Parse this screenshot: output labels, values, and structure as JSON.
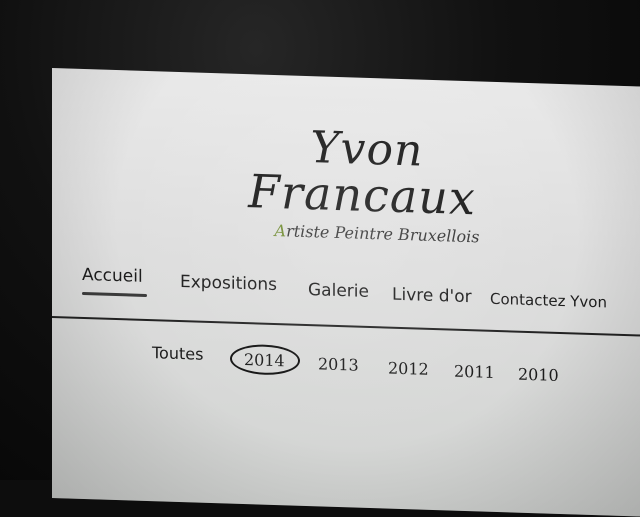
{
  "site": {
    "name_line1": "Yvon",
    "name_line2": "Francaux",
    "tagline_first": "A",
    "tagline_rest": "rtiste Peintre Bruxellois"
  },
  "nav": {
    "items": [
      {
        "label": "Accueil",
        "active": true
      },
      {
        "label": "Expositions",
        "active": false
      },
      {
        "label": "Galerie",
        "active": false
      },
      {
        "label": "Livre d'or",
        "active": false
      },
      {
        "label": "Contactez Yvon",
        "active": false
      }
    ]
  },
  "filters": {
    "items": [
      {
        "label": "Toutes",
        "selected": false
      },
      {
        "label": "2014",
        "selected": true
      },
      {
        "label": "2013",
        "selected": false
      },
      {
        "label": "2012",
        "selected": false
      },
      {
        "label": "2011",
        "selected": false
      },
      {
        "label": "2010",
        "selected": false
      }
    ]
  },
  "colors": {
    "tagline_accent": "#6e8a2e",
    "text": "#161616",
    "background": "#e2e2e2"
  }
}
